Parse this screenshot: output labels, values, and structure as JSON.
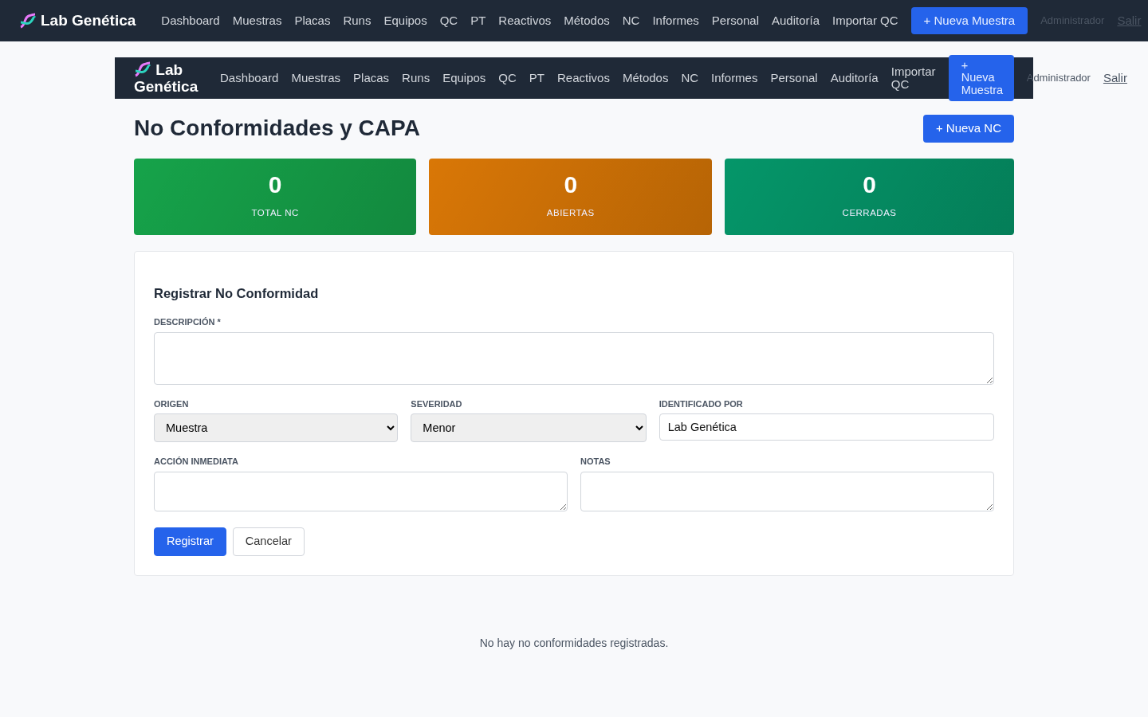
{
  "top_nav": {
    "brand": "Lab Genética",
    "links": [
      "Dashboard",
      "Muestras",
      "Placas",
      "Runs",
      "Equipos",
      "QC",
      "PT",
      "Reactivos",
      "Métodos",
      "NC",
      "Informes",
      "Personal",
      "Auditoría",
      "Importar QC"
    ],
    "button": "+ Nueva Muestra",
    "user": "Administrador",
    "logout": "Salir"
  },
  "inner_nav": {
    "brand": "Lab Genética",
    "links": [
      "Dashboard",
      "Muestras",
      "Placas",
      "Runs",
      "Equipos",
      "QC",
      "PT",
      "Reactivos",
      "Métodos",
      "NC",
      "Informes",
      "Personal",
      "Auditoría",
      "Importar QC"
    ],
    "button": "+ Nueva Muestra",
    "user": "Administrador",
    "logout": "Salir"
  },
  "page_title": "No Conformidades y CAPA",
  "new_button": "+ Nueva NC",
  "stats": [
    {
      "value": "0",
      "label": "TOTAL NC",
      "color": "#16a34a"
    },
    {
      "value": "0",
      "label": "ABIERTAS",
      "color": "#d97706"
    },
    {
      "value": "0",
      "label": "CERRADAS",
      "color": "#059669"
    }
  ],
  "form": {
    "title": "Registrar No Conformidad",
    "rows": [
      [
        {
          "label": "DESCRIPCIÓN *",
          "kind": "textarea"
        }
      ],
      [
        {
          "label": "ORIGEN",
          "kind": "select",
          "value": "Muestra"
        },
        {
          "label": "SEVERIDAD",
          "kind": "select",
          "value": "Menor"
        },
        {
          "label": "IDENTIFICADO POR",
          "kind": "input",
          "value": "Lab Genética"
        }
      ],
      [
        {
          "label": "ACCIÓN INMEDIATA",
          "kind": "textarea"
        },
        {
          "label": "NOTAS",
          "kind": "textarea"
        }
      ]
    ],
    "buttons": [
      {
        "label": "Registrar",
        "kind": "primary"
      },
      {
        "label": "Cancelar",
        "kind": "secondary"
      }
    ]
  },
  "empty_message": "No hay no conformidades registradas."
}
